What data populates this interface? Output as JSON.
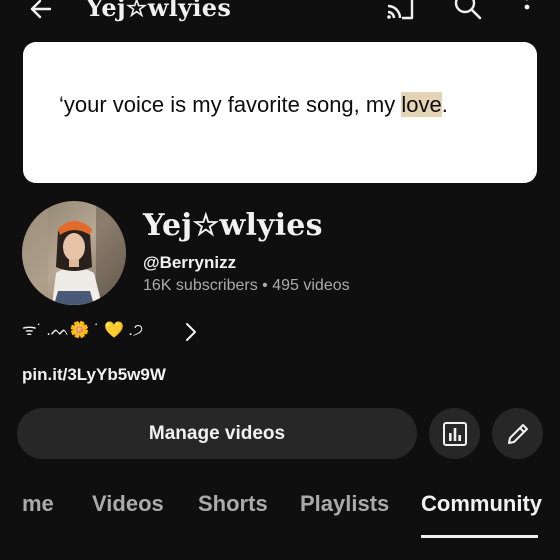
{
  "header": {
    "back_icon": "arrow-left-icon",
    "title": "Yej☆wlyies",
    "cast_icon": "cast-icon",
    "search_icon": "search-icon",
    "more_icon": "more-vertical-icon"
  },
  "banner": {
    "text_before": "‘your voice is my favorite song, my ",
    "text_highlight": "love",
    "text_after": "."
  },
  "channel": {
    "name": "Yej☆wlyies",
    "handle": "@Berrynizz",
    "subscribers": "16K subscribers",
    "separator": " • ",
    "videos": "495 videos",
    "about_text": "ᯤ˙  .ᨓ🌼  ˙  💛 .੭",
    "about_chevron_icon": "chevron-right-icon",
    "link": "pin.it/3LyYb5w9W"
  },
  "actions": {
    "manage_label": "Manage videos",
    "analytics_icon": "bar-chart-icon",
    "edit_icon": "pencil-icon"
  },
  "tabs": [
    {
      "label": "me",
      "active": false
    },
    {
      "label": "Videos",
      "active": false
    },
    {
      "label": "Shorts",
      "active": false
    },
    {
      "label": "Playlists",
      "active": false
    },
    {
      "label": "Community",
      "active": true
    }
  ],
  "colors": {
    "background": "#0f0f0f",
    "button": "#272727",
    "text": "#f1f1f1",
    "muted": "#aaaaaa",
    "highlight": "#e4d3b4"
  }
}
